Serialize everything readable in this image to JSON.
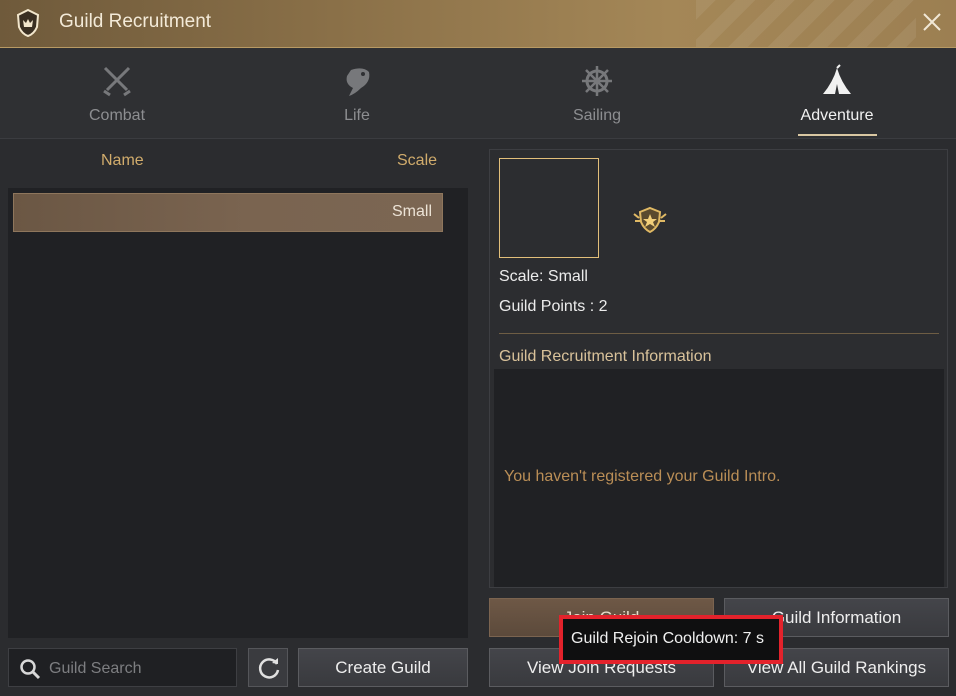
{
  "window": {
    "title": "Guild Recruitment"
  },
  "tabs": [
    {
      "label": "Combat",
      "icon": "crossed-swords-icon",
      "active": false
    },
    {
      "label": "Life",
      "icon": "fish-icon",
      "active": false
    },
    {
      "label": "Sailing",
      "icon": "ship-wheel-icon",
      "active": false
    },
    {
      "label": "Adventure",
      "icon": "tent-icon",
      "active": true
    }
  ],
  "list": {
    "headers": {
      "name": "Name",
      "scale": "Scale"
    },
    "rows": [
      {
        "name": "",
        "scale": "Small"
      }
    ]
  },
  "search": {
    "placeholder": "Guild Search",
    "value": ""
  },
  "buttons": {
    "create_guild": "Create Guild",
    "join_guild": "Join Guild",
    "guild_information": "Guild Information",
    "view_join_requests": "View Join Requests",
    "view_all_rankings": "View All Guild Rankings"
  },
  "details": {
    "scale_text": "Scale: Small",
    "points_text": "Guild Points : 2",
    "recruitment_title": "Guild Recruitment Information",
    "intro_text": "You haven't registered your Guild Intro."
  },
  "tooltip": {
    "text": "Guild Rejoin Cooldown: 7 s"
  },
  "colors": {
    "accent_gold": "#d1ac6c",
    "title_bar": "#8a7048",
    "highlight_red": "#e3222b"
  }
}
